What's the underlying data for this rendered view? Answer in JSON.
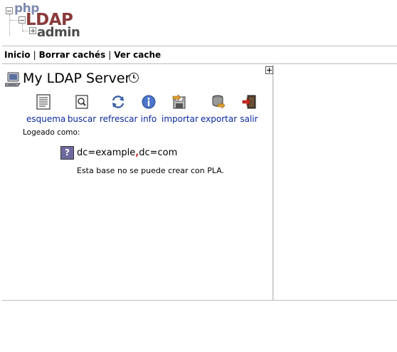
{
  "logo": {
    "php": "php",
    "ldap": "LDAP",
    "admin": "admin"
  },
  "topmenu": {
    "home": "Inicio",
    "clear_cache": "Borrar cachés",
    "view_cache": "Ver cache",
    "separator": "|"
  },
  "server": {
    "name": "My LDAP Server"
  },
  "actions": [
    {
      "label": "esquema",
      "icon": "schema-icon"
    },
    {
      "label": "buscar",
      "icon": "search-icon"
    },
    {
      "label": "refrescar",
      "icon": "refresh-icon"
    },
    {
      "label": "info",
      "icon": "info-icon"
    },
    {
      "label": "importar",
      "icon": "import-icon"
    },
    {
      "label": "exportar",
      "icon": "export-icon"
    },
    {
      "label": "salir",
      "icon": "logout-icon"
    }
  ],
  "login": {
    "label": "Logeado como:"
  },
  "tree": {
    "dn_part1": "dc=example",
    "dn_sep": ",",
    "dn_part2": "dc=com",
    "message": "Esta base no se puede crear con PLA."
  },
  "colors": {
    "link": "#0a2aa0",
    "dn_comma": "#d0261d",
    "separator": "#bdbdbd"
  }
}
